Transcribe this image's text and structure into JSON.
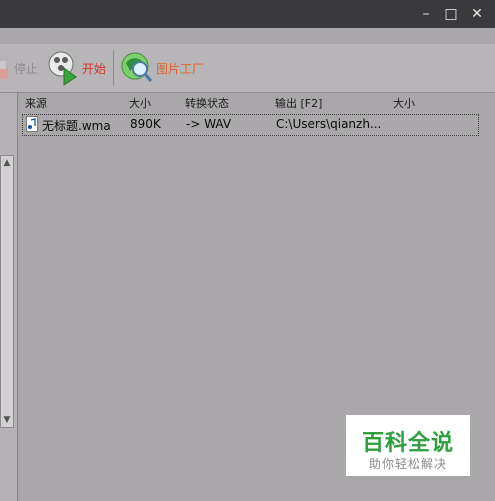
{
  "window": {
    "minimize_glyph": "–",
    "maximize_glyph": "□",
    "close_glyph": "✕"
  },
  "toolbar": {
    "stop_label": "停止",
    "start_label": "开始",
    "factory_label": "图片工厂",
    "start_color": "#d1352b",
    "factory_color": "#e0622c"
  },
  "table": {
    "headers": [
      "来源",
      "大小",
      "转换状态",
      "输出 [F2]",
      "大小"
    ],
    "rows": [
      {
        "source": "无标题.wma",
        "size": "890K",
        "status": "-> WAV",
        "output": "C:\\Users\\qianzh...",
        "out_size": ""
      }
    ]
  },
  "watermark": {
    "title": "百科全说",
    "subtitle": "助你轻松解决"
  },
  "icons": {
    "stop": "stop-icon",
    "start": "start-icon",
    "factory": "image-factory-icon",
    "file": "audio-file-icon"
  }
}
